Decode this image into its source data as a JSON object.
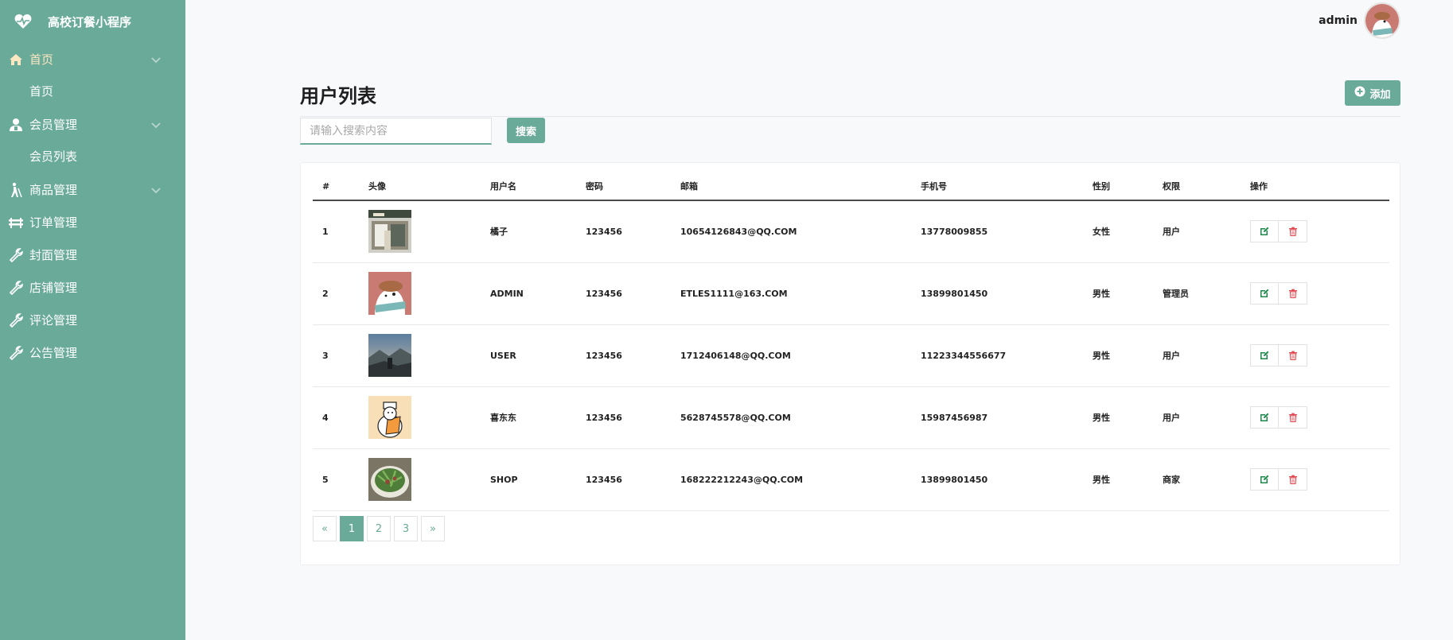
{
  "app": {
    "title": "高校订餐小程序"
  },
  "sidebar": {
    "items": [
      {
        "label": "首页",
        "icon": "home-icon",
        "expandable": true,
        "active": true,
        "children": [
          "首页"
        ]
      },
      {
        "label": "会员管理",
        "icon": "user-icon",
        "expandable": true,
        "children": [
          "会员列表"
        ]
      },
      {
        "label": "商品管理",
        "icon": "walker-icon",
        "expandable": true,
        "children": []
      },
      {
        "label": "订单管理",
        "icon": "bench-icon",
        "expandable": false
      },
      {
        "label": "封面管理",
        "icon": "wrench-icon",
        "expandable": false
      },
      {
        "label": "店铺管理",
        "icon": "wrench-icon",
        "expandable": false
      },
      {
        "label": "评论管理",
        "icon": "wrench-icon",
        "expandable": false
      },
      {
        "label": "公告管理",
        "icon": "wrench-icon",
        "expandable": false
      }
    ]
  },
  "header": {
    "username": "admin"
  },
  "main": {
    "title": "用户列表",
    "add_label": "添加",
    "search": {
      "placeholder": "请输入搜索内容",
      "value": "",
      "button_label": "搜索"
    },
    "table": {
      "columns": [
        "#",
        "头像",
        "用户名",
        "密码",
        "邮箱",
        "手机号",
        "性别",
        "权限",
        "操作"
      ],
      "rows": [
        {
          "id": "1",
          "avatar": "storefront-photo",
          "username": "橘子",
          "password": "123456",
          "email": "10654126843@QQ.COM",
          "phone": "13778009855",
          "gender": "女性",
          "role": "用户"
        },
        {
          "id": "2",
          "avatar": "bear-cartoon",
          "username": "ADMIN",
          "password": "123456",
          "email": "ETLES1111@163.COM",
          "phone": "13899801450",
          "gender": "男性",
          "role": "管理员"
        },
        {
          "id": "3",
          "avatar": "mountain-photo",
          "username": "USER",
          "password": "123456",
          "email": "1712406148@QQ.COM",
          "phone": "11223344556677",
          "gender": "男性",
          "role": "用户"
        },
        {
          "id": "4",
          "avatar": "chef-cartoon",
          "username": "喜东东",
          "password": "123456",
          "email": "5628745578@QQ.COM",
          "phone": "15987456987",
          "gender": "男性",
          "role": "用户"
        },
        {
          "id": "5",
          "avatar": "food-bowl-photo",
          "username": "SHOP",
          "password": "123456",
          "email": "168222212243@QQ.COM",
          "phone": "13899801450",
          "gender": "男性",
          "role": "商家"
        }
      ]
    },
    "pagination": {
      "prev": "«",
      "pages": [
        "1",
        "2",
        "3"
      ],
      "current": "1",
      "next": "»"
    }
  },
  "colors": {
    "accent": "#6aaa98",
    "active_menu_text": "#fbe7c2",
    "edit_icon": "#1c8a4a",
    "delete_icon": "#e0474f"
  }
}
